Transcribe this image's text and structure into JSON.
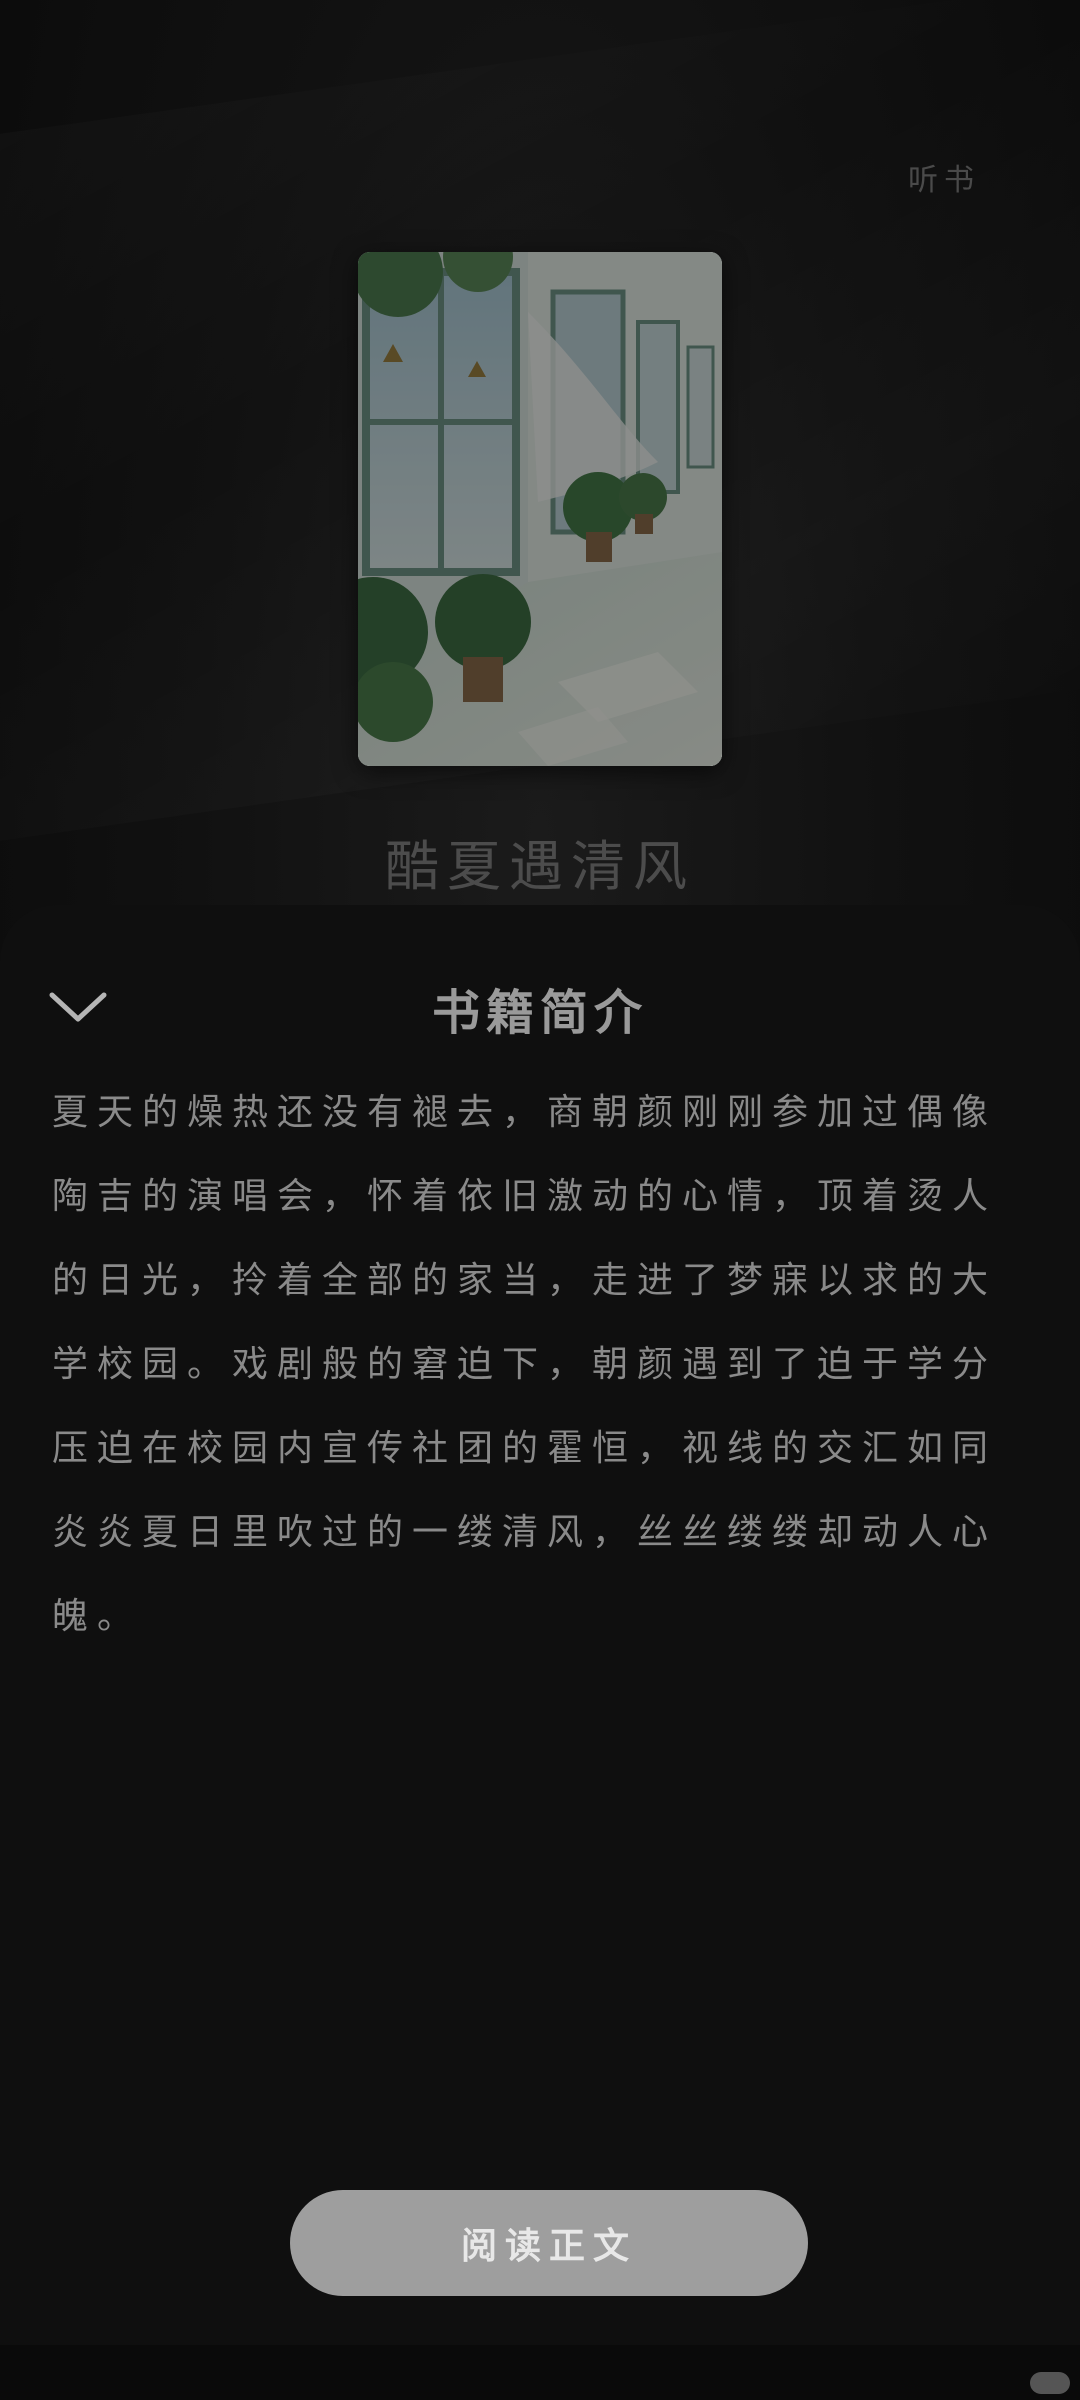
{
  "header": {
    "listen_label": "听书"
  },
  "book": {
    "title": "酷夏遇清风",
    "cover_description_icon": "book-cover-image"
  },
  "intro_sheet": {
    "title": "书籍简介",
    "collapse_icon": "chevron-down-icon",
    "synopsis": "夏天的燥热还没有褪去，商朝颜刚刚参加过偶像陶吉的演唱会，怀着依旧激动的心情，顶着烫人的日光，拎着全部的家当，走进了梦寐以求的大学校园。戏剧般的窘迫下，朝颜遇到了迫于学分压迫在校园内宣传社团的霍恒，视线的交汇如同炎炎夏日里吹过的一缕清风，丝丝缕缕却动人心魄。"
  },
  "actions": {
    "read_label": "阅读正文"
  },
  "colors": {
    "background": "#0b0b0b",
    "sheet": "#0f0f0f",
    "button": "#9e9e9e",
    "text_primary": "#9a9a9a",
    "text_body": "#8a8a8a"
  }
}
